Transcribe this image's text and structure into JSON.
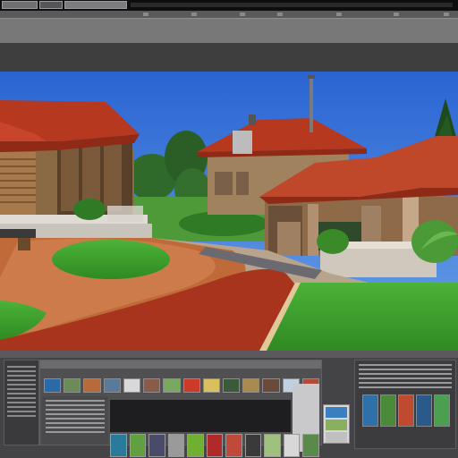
{
  "app": {
    "title": ""
  },
  "colors": {
    "sky": "#2e6fd6",
    "roof": "#b5381f",
    "grass": "#3fa82f",
    "path": "#a8341e",
    "wall": "#a07a55",
    "panel_bg": "#444446",
    "toolbar": "#787878"
  },
  "icons": {
    "menu": [
      "menu-thumbnail-1",
      "menu-thumbnail-2",
      "menu-thumbnail-3"
    ],
    "toolbar": [
      "tool-icon"
    ]
  },
  "viewport": {
    "scene": "3d-house-render",
    "objects": [
      "left-house",
      "center-house",
      "right-house",
      "lawn",
      "path",
      "trees",
      "antenna"
    ]
  },
  "library": {
    "thumbnails_top": [
      "#2a6aa8",
      "#6c8a5a",
      "#b86a3a",
      "#5a7a9a",
      "#d8d8d8",
      "#8a5a4a",
      "#7aa860",
      "#cc3a2a",
      "#d8c060",
      "#3a5a3a",
      "#aa8a50",
      "#6a4a3a",
      "#c0d0e0",
      "#b04a3a"
    ],
    "thumbnails_bottom": [
      "#2a7a9a",
      "#60a040",
      "#4a4a6a",
      "#9a9a9a",
      "#70b030",
      "#b02a2a",
      "#c04a3a",
      "#3a3a3a",
      "#a0c080",
      "#d8d8d8",
      "#5a8a4a"
    ],
    "mini_thumbs": [
      "#3a80c0",
      "#88b060",
      "#c0c0c0"
    ],
    "right_bars": [
      "#3070a8",
      "#4a8a3a",
      "#c04a30",
      "#2a5a8a",
      "#4aa050"
    ]
  }
}
